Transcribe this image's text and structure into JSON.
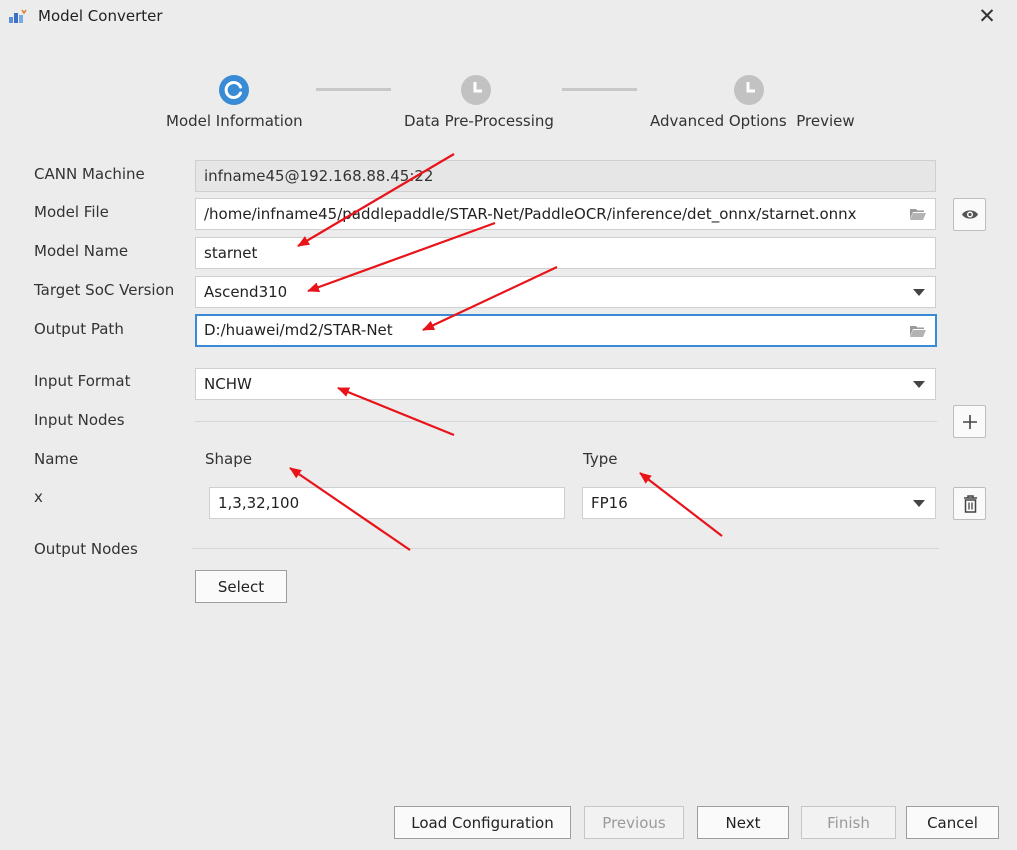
{
  "window": {
    "title": "Model Converter",
    "close_glyph": "✕"
  },
  "stepper": {
    "steps": [
      {
        "label": "Model Information",
        "state": "active",
        "icon": "progress-icon"
      },
      {
        "label": "Data Pre-Processing",
        "state": "pending",
        "icon": "clock-icon"
      },
      {
        "label": "Advanced Options  Preview",
        "state": "pending",
        "icon": "clock-icon"
      }
    ],
    "active_color": "#3a8bd6",
    "pending_color": "#c2c2c2"
  },
  "form": {
    "cann_machine": {
      "label": "CANN Machine",
      "value": "infname45@192.168.88.45:22"
    },
    "model_file": {
      "label": "Model File",
      "value": "/home/infname45/paddlepaddle/STAR-Net/PaddleOCR/inference/det_onnx/starnet.onnx"
    },
    "model_name": {
      "label": "Model Name",
      "value": "starnet"
    },
    "target_soc": {
      "label": "Target SoC Version",
      "value": "Ascend310"
    },
    "output_path": {
      "label": "Output Path",
      "value": "D:/huawei/md2/STAR-Net"
    },
    "input_format": {
      "label": "Input Format",
      "value": "NCHW"
    },
    "input_nodes": {
      "label": "Input Nodes",
      "columns": {
        "name": "Name",
        "shape": "Shape",
        "type": "Type"
      },
      "rows": [
        {
          "name": "x",
          "shape": "1,3,32,100",
          "type": "FP16"
        }
      ]
    },
    "output_nodes": {
      "label": "Output Nodes",
      "select_label": "Select"
    }
  },
  "footer": {
    "load_configuration": "Load Configuration",
    "previous": "Previous",
    "next": "Next",
    "finish": "Finish",
    "cancel": "Cancel"
  },
  "colors": {
    "annotation_arrow": "#e8141a",
    "focus_border": "#3a8bd6"
  }
}
